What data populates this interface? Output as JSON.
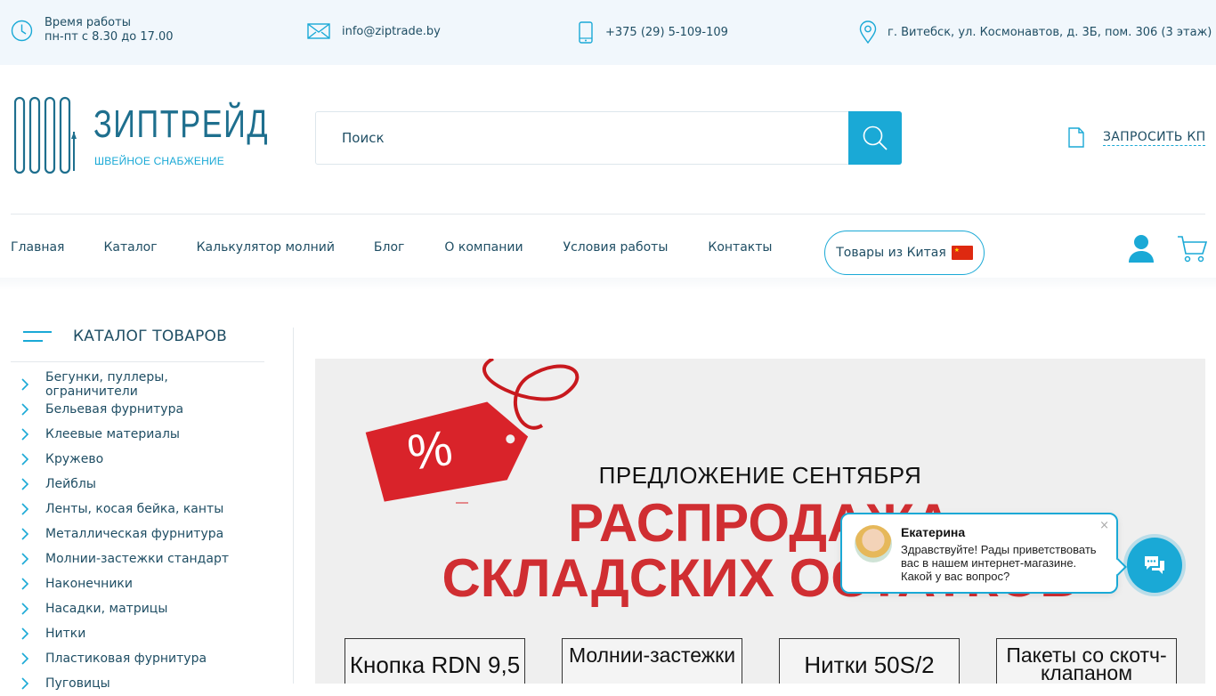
{
  "topbar": {
    "hours_title": "Время работы",
    "hours_value": "пн-пт с 8.30 до 17.00",
    "email": "info@ziptrade.by",
    "phone": "+375 (29) 5-109-109",
    "address": "г. Витебск, ул. Космонавтов, д. 3Б, пом. 306 (3 этаж)"
  },
  "logo": {
    "name": "ЗИПТРЕЙД",
    "tagline": "ШВЕЙНОЕ СНАБЖЕНИЕ"
  },
  "search": {
    "placeholder": "Поиск"
  },
  "request_kp": "ЗАПРОСИТЬ КП",
  "nav": {
    "items": [
      "Главная",
      "Каталог",
      "Калькулятор молний",
      "Блог",
      "О компании",
      "Условия работы",
      "Контакты"
    ],
    "china_button": "Товары из Китая"
  },
  "catalog": {
    "title": "КАТАЛОГ ТОВАРОВ",
    "items": [
      "Бегунки, пуллеры, ограничители",
      "Бельевая фурнитура",
      "Клеевые материалы",
      "Кружево",
      "Лейблы",
      "Ленты, косая бейка, канты",
      "Металлическая фурнитура",
      "Молнии-застежки стандарт",
      "Наконечники",
      "Насадки, матрицы",
      "Нитки",
      "Пластиковая фурнитура",
      "Пуговицы"
    ]
  },
  "banner": {
    "tag_symbol": "%",
    "subtitle": "ПРЕДЛОЖЕНИЕ СЕНТЯБРЯ",
    "title_line1": "РАСПРОДАЖА",
    "title_line2": "СКЛАДСКИХ ОСТАТКОВ",
    "boxes": [
      "Кнопка RDN 9,5",
      "Молнии-застежки",
      "Нитки 50S/2",
      "Пакеты со скотч-клапаном"
    ]
  },
  "chat": {
    "agent_name": "Екатерина",
    "message": "Здравствуйте! Рады приветствовать вас в нашем интернет-магазине. Какой у вас вопрос?",
    "close": "×"
  },
  "colors": {
    "accent": "#1aa9d6",
    "text": "#1f4e64",
    "sale_red": "#d02e32",
    "topbar_bg": "#f1f7fc"
  }
}
